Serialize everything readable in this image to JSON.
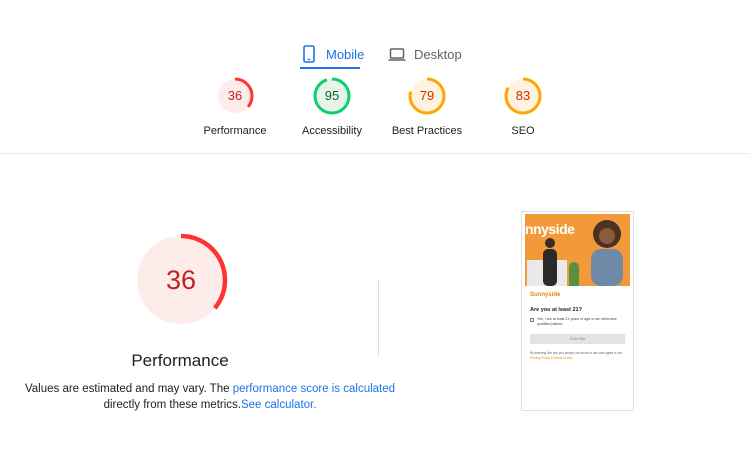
{
  "tabs": [
    {
      "label": "Mobile",
      "icon": "smartphone-icon",
      "selected": true
    },
    {
      "label": "Desktop",
      "icon": "laptop-icon",
      "selected": false
    }
  ],
  "colors": {
    "accent": "#1a73e8",
    "fail": "#ff3333",
    "fail_text": "#c5221f",
    "fail_bg": "#fdecea",
    "pass": "#0cce6b",
    "pass_text": "#0d652d",
    "pass_bg": "#e6f4ea",
    "average": "#ffa400",
    "average_text": "#c33300",
    "average_bg": "#fff3e0"
  },
  "scores": [
    {
      "value": "36",
      "label": "Performance",
      "score_fraction": 0.36,
      "status": "fail"
    },
    {
      "value": "95",
      "label": "Accessibility",
      "score_fraction": 0.95,
      "status": "pass"
    },
    {
      "value": "79",
      "label": "Best Practices",
      "score_fraction": 0.79,
      "status": "average"
    },
    {
      "value": "83",
      "label": "SEO",
      "score_fraction": 0.83,
      "status": "average"
    }
  ],
  "performance": {
    "value": "36",
    "score_fraction": 0.36,
    "title": "Performance",
    "note_prefix": "Values are estimated and may vary. The ",
    "note_link": "performance score is calculated",
    "note_middle": " directly from these metrics.",
    "calculator_link": "See calculator."
  },
  "screenshot": {
    "hero_text": "nnyside",
    "brand": "Sunnyside",
    "question": "Are you at least 21?",
    "checkbox_text": "Yes, I am at least 21 years of age or am otherwise qualified patient.",
    "button": "Enter Site",
    "fine_print": "By entering this site you accept our terms of use and agree to our ",
    "fine_link": "Privacy Policy & Terms of Use"
  }
}
